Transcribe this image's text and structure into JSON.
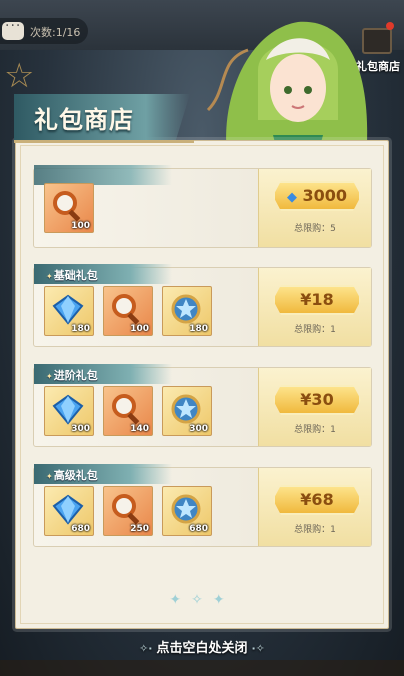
{
  "background": {
    "counter_text": "次数:1/16",
    "gift_label": "礼包商店"
  },
  "title": "礼包商店",
  "rows": [
    {
      "name": "",
      "items": [
        {
          "kind": "magnifier",
          "count": "100"
        }
      ],
      "price": "3000",
      "price_icon": "diamond-icon",
      "limit": "总限购：5"
    },
    {
      "name": "基础礼包",
      "items": [
        {
          "kind": "diamond",
          "count": "180"
        },
        {
          "kind": "magnifier",
          "count": "100"
        },
        {
          "kind": "star-orb",
          "count": "180"
        }
      ],
      "price": "¥18",
      "limit": "总限购：1"
    },
    {
      "name": "进阶礼包",
      "items": [
        {
          "kind": "diamond",
          "count": "300"
        },
        {
          "kind": "magnifier",
          "count": "140"
        },
        {
          "kind": "star-orb",
          "count": "300"
        }
      ],
      "price": "¥30",
      "limit": "总限购：1"
    },
    {
      "name": "高级礼包",
      "items": [
        {
          "kind": "diamond",
          "count": "680"
        },
        {
          "kind": "magnifier",
          "count": "250"
        },
        {
          "kind": "star-orb",
          "count": "680"
        }
      ],
      "price": "¥68",
      "limit": "总限购：1"
    }
  ],
  "hint": "点击空白处关闭",
  "colors": {
    "accent_teal": "#3b6a72",
    "price_gold": "#f0b93e",
    "panel_bg": "#f3efe3"
  }
}
